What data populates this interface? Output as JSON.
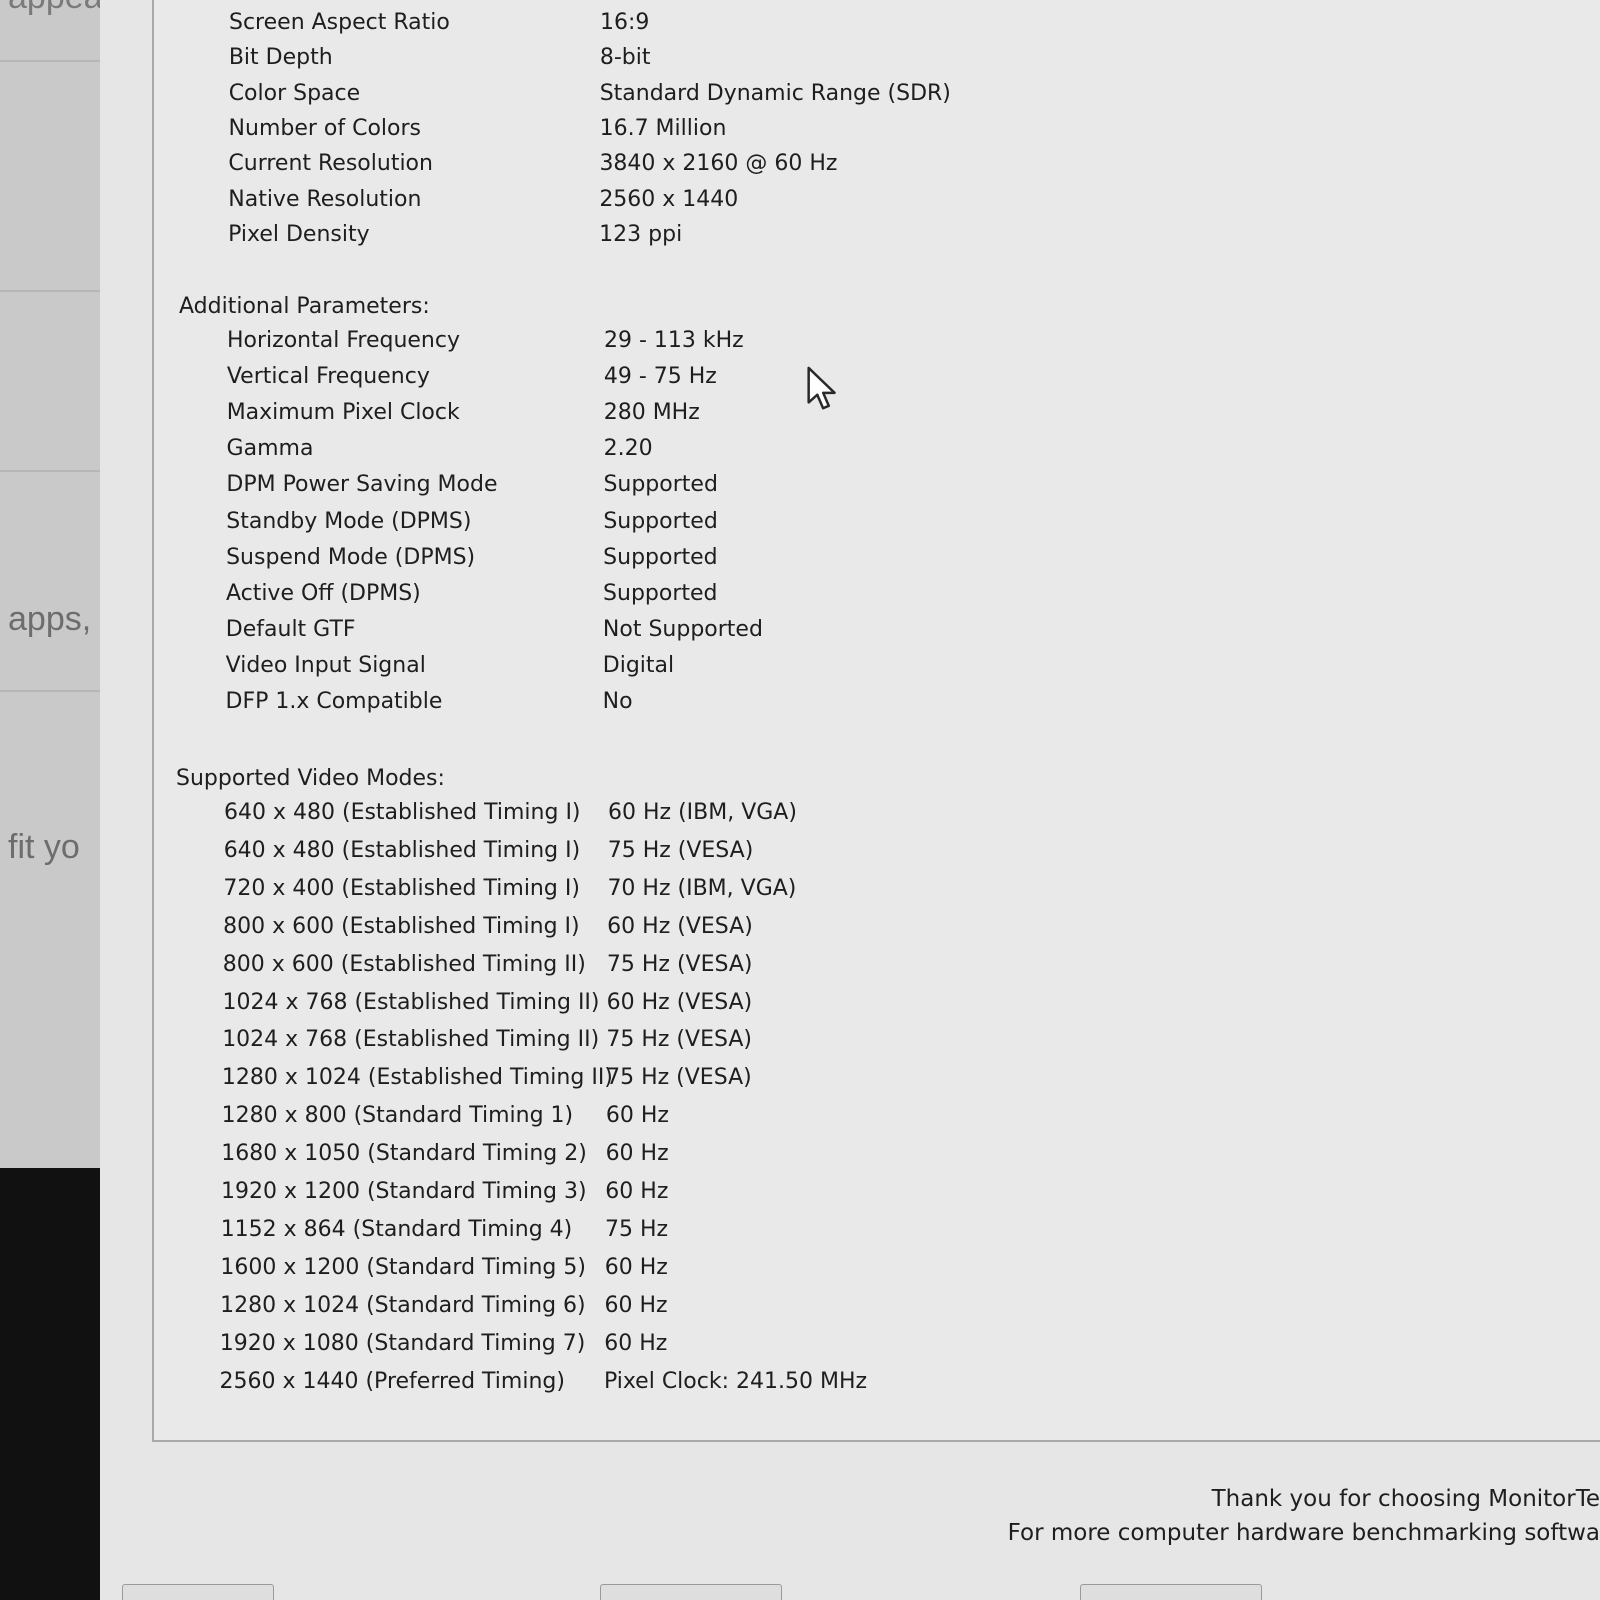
{
  "background_app": {
    "fragments": [
      "appear",
      "apps,",
      "fit yo"
    ]
  },
  "display_params": [
    {
      "label": "Screen Aspect Ratio",
      "value": "16:9"
    },
    {
      "label": "Bit Depth",
      "value": "8-bit"
    },
    {
      "label": "Color Space",
      "value": "Standard Dynamic Range (SDR)"
    },
    {
      "label": "Number of Colors",
      "value": "16.7 Million"
    },
    {
      "label": "Current Resolution",
      "value": "3840 x 2160 @ 60 Hz"
    },
    {
      "label": "Native Resolution",
      "value": "2560 x 1440"
    },
    {
      "label": "Pixel Density",
      "value": "123 ppi"
    }
  ],
  "additional": {
    "title": "Additional Parameters:",
    "rows": [
      {
        "label": "Horizontal Frequency",
        "value": "29 - 113 kHz"
      },
      {
        "label": "Vertical Frequency",
        "value": "49 - 75 Hz"
      },
      {
        "label": "Maximum Pixel Clock",
        "value": "280 MHz"
      },
      {
        "label": "Gamma",
        "value": "2.20"
      },
      {
        "label": "DPM Power Saving Mode",
        "value": "Supported"
      },
      {
        "label": "Standby Mode (DPMS)",
        "value": "Supported"
      },
      {
        "label": "Suspend Mode (DPMS)",
        "value": "Supported"
      },
      {
        "label": "Active Off (DPMS)",
        "value": "Supported"
      },
      {
        "label": "Default GTF",
        "value": "Not Supported"
      },
      {
        "label": "Video Input Signal",
        "value": "Digital"
      },
      {
        "label": "DFP 1.x Compatible",
        "value": "No"
      }
    ]
  },
  "video_modes": {
    "title": "Supported Video Modes:",
    "rows": [
      {
        "label": "640 x 480 (Established Timing I)",
        "value": "60 Hz (IBM, VGA)"
      },
      {
        "label": "640 x 480 (Established Timing I)",
        "value": "75 Hz (VESA)"
      },
      {
        "label": "720 x 400 (Established Timing I)",
        "value": "70 Hz (IBM, VGA)"
      },
      {
        "label": "800 x 600 (Established Timing I)",
        "value": "60 Hz (VESA)"
      },
      {
        "label": "800 x 600 (Established Timing II)",
        "value": "75 Hz (VESA)"
      },
      {
        "label": "1024 x 768 (Established Timing II)",
        "value": "60 Hz (VESA)"
      },
      {
        "label": "1024 x 768 (Established Timing II)",
        "value": "75 Hz (VESA)"
      },
      {
        "label": "1280 x 1024 (Established Timing II)",
        "value": "75 Hz (VESA)"
      },
      {
        "label": "1280 x 800 (Standard Timing 1)",
        "value": "60 Hz"
      },
      {
        "label": "1680 x 1050 (Standard Timing 2)",
        "value": "60 Hz"
      },
      {
        "label": "1920 x 1200 (Standard Timing 3)",
        "value": "60 Hz"
      },
      {
        "label": "1152 x 864 (Standard Timing 4)",
        "value": "75 Hz"
      },
      {
        "label": "1600 x 1200 (Standard Timing 5)",
        "value": "60 Hz"
      },
      {
        "label": "1280 x 1024 (Standard Timing 6)",
        "value": "60 Hz"
      },
      {
        "label": "1920 x 1080 (Standard Timing 7)",
        "value": "60 Hz"
      },
      {
        "label": "2560 x 1440 (Preferred Timing)",
        "value": "Pixel Clock: 241.50 MHz"
      }
    ]
  },
  "footer": {
    "line1": "Thank you for choosing MonitorTe",
    "line2": "For more computer hardware benchmarking softwa"
  },
  "icons": {
    "cursor": "mouse-pointer-icon"
  }
}
